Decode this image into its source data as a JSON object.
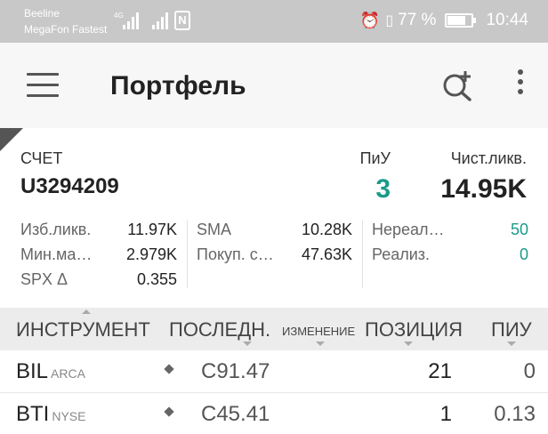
{
  "status_bar": {
    "carrier_1": "Beeline",
    "carrier_2": "MegaFon Fastest",
    "network_type": "4G",
    "nfc_label": "N",
    "battery_text": "77 %",
    "battery_level_pct": 77,
    "time": "10:44"
  },
  "app_bar": {
    "title": "Портфель",
    "icons": [
      "menu-icon",
      "search-add-icon",
      "more-vert-icon"
    ]
  },
  "account": {
    "label": "СЧЕТ",
    "number": "U3294209",
    "piu_label": "ПиУ",
    "piu_value": "3",
    "net_liq_label": "Чист.ликв.",
    "net_liq_value": "14.95K"
  },
  "metrics": {
    "col1": [
      {
        "label": "Изб.ликв.",
        "value": "11.97K"
      },
      {
        "label": "Мин.ма…",
        "value": "2.979K"
      },
      {
        "label": "SPX Δ",
        "value": "0.355"
      }
    ],
    "col2": [
      {
        "label": "SMA",
        "value": "10.28K"
      },
      {
        "label": "Покуп. с…",
        "value": "47.63K"
      }
    ],
    "col3": [
      {
        "label": "Нереал…",
        "value": "50"
      },
      {
        "label": "Реализ.",
        "value": "0"
      }
    ]
  },
  "table": {
    "columns": {
      "instrument": "ИНСТРУМЕНТ",
      "last": "ПОСЛЕДН.",
      "change": "ИЗМЕНЕНИЕ",
      "position": "ПОЗИЦИЯ",
      "pnl": "ПИУ"
    },
    "rows": [
      {
        "symbol": "BIL",
        "exchange": "ARCA",
        "last": "C91.47",
        "position": "21",
        "pnl": "0"
      },
      {
        "symbol": "BTI",
        "exchange": "NYSE",
        "last": "C45.41",
        "position": "1",
        "pnl": "0.13"
      }
    ]
  },
  "colors": {
    "accent_teal": "#1a9a8a",
    "status_bar": "#c8c8c8",
    "header_bg": "#ececec"
  }
}
